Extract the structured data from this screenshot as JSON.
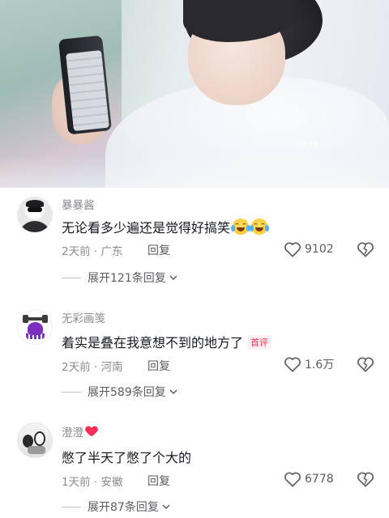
{
  "video": {
    "watermark": "@宋子辰"
  },
  "comments": [
    {
      "username": "暴暴酱",
      "text": "无论看多少遍还是觉得好搞笑",
      "emojis": [
        "crying-laughing",
        "crying-laughing"
      ],
      "time_location": "2天前 · 广东",
      "reply_label": "回复",
      "likes": "9102",
      "expand_label": "展开121条回复"
    },
    {
      "username": "无彩画笺",
      "text": "着实是叠在我意想不到的地方了",
      "badge": "首评",
      "time_location": "2天前 · 河南",
      "reply_label": "回复",
      "likes": "1.6万",
      "expand_label": "展开589条回复"
    },
    {
      "username": "澄澄",
      "text": "憋了半天了憋了个大的",
      "time_location": "1天前 · 安徽",
      "reply_label": "回复",
      "likes": "6778",
      "expand_label": "展开87条回复"
    }
  ],
  "colors": {
    "accent": "#fe2c55",
    "text": "#161823",
    "muted": "#8a8b91"
  }
}
